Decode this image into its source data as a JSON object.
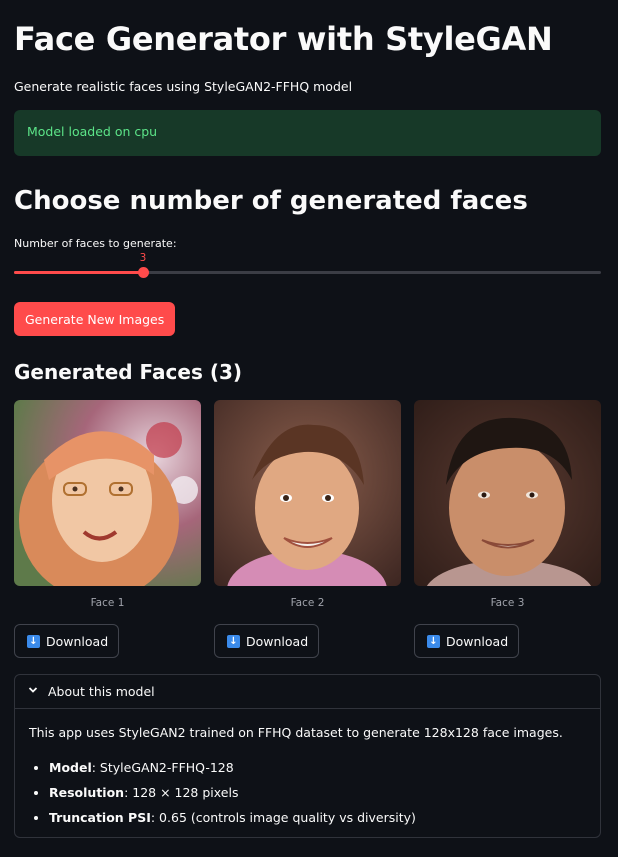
{
  "header": {
    "title": "Face Generator with StyleGAN",
    "subtitle": "Generate realistic faces using StyleGAN2-FFHQ model"
  },
  "status": {
    "message": "Model loaded on cpu"
  },
  "controls": {
    "section_title": "Choose number of generated faces",
    "slider_label": "Number of faces to generate:",
    "slider_value": 3,
    "slider_value_text": "3",
    "slider_fraction": 0.22,
    "generate_button": "Generate New Images"
  },
  "results": {
    "title": "Generated Faces (3)",
    "faces": [
      {
        "caption": "Face 1",
        "download_label": "Download"
      },
      {
        "caption": "Face 2",
        "download_label": "Download"
      },
      {
        "caption": "Face 3",
        "download_label": "Download"
      }
    ]
  },
  "about": {
    "header": "About this model",
    "description": "This app uses StyleGAN2 trained on FFHQ dataset to generate 128x128 face images.",
    "items": [
      {
        "label": "Model",
        "value": ": StyleGAN2-FFHQ-128"
      },
      {
        "label": "Resolution",
        "value": ": 128 × 128 pixels"
      },
      {
        "label": "Truncation PSI",
        "value": ": 0.65 (controls image quality vs diversity)"
      }
    ]
  },
  "colors": {
    "accent": "#ff4b4b",
    "success_text": "#5ce488",
    "background": "#0e1117"
  },
  "icons": {
    "download": "download-arrow-icon",
    "expander": "chevron-down-icon"
  }
}
